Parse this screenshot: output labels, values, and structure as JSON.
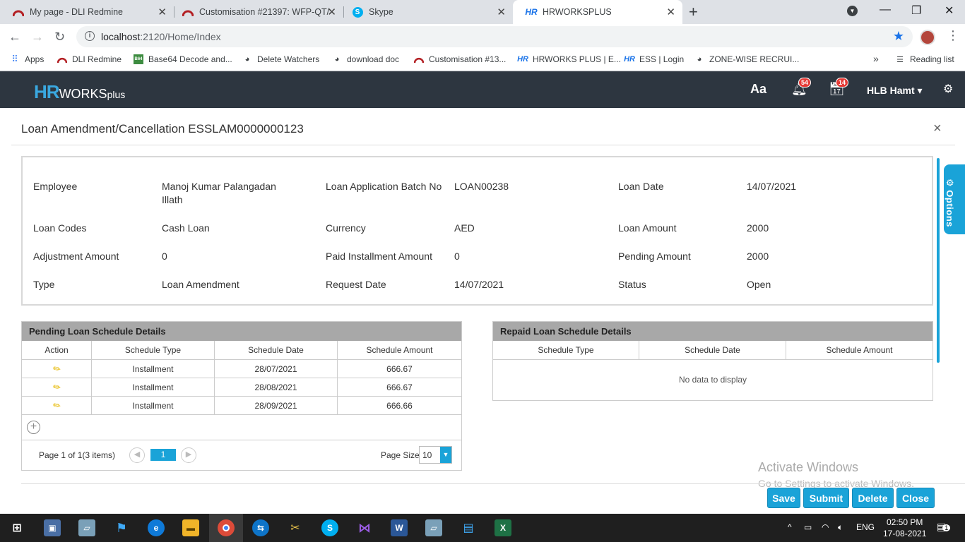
{
  "browser": {
    "tabs": [
      {
        "title": "My page - DLI Redmine",
        "active": false
      },
      {
        "title": "Customisation #21397: WFP-QT/",
        "active": false
      },
      {
        "title": "Skype",
        "active": false
      },
      {
        "title": "HRWORKSPLUS",
        "active": true
      }
    ],
    "url_host": "localhost",
    "url_path": ":2120/Home/Index",
    "bookmarks": [
      "Apps",
      "DLI Redmine",
      "Base64 Decode and...",
      "Delete Watchers",
      "download doc",
      "Customisation #13...",
      "HRWORKS PLUS | E...",
      "ESS | Login",
      "ZONE-WISE RECRUI..."
    ],
    "bookmarks_more": "»",
    "reading_list": "Reading list"
  },
  "app": {
    "logo_hr": "HR",
    "logo_works": "WORKS",
    "logo_plus": "plus",
    "font_icon": "Aa",
    "notif_count": "54",
    "task_count": "14",
    "user": "HLB Hamt ▾"
  },
  "page": {
    "title": "Loan Amendment/Cancellation ESSLAM0000000123",
    "close": "×",
    "options_label": "Options"
  },
  "info": {
    "employee_label": "Employee",
    "employee": "Manoj Kumar Palangadan Illath",
    "batch_label": "Loan Application Batch No",
    "batch": "LOAN00238",
    "loan_date_label": "Loan Date",
    "loan_date": "14/07/2021",
    "loan_codes_label": "Loan Codes",
    "loan_codes": "Cash Loan",
    "currency_label": "Currency",
    "currency": "AED",
    "loan_amount_label": "Loan Amount",
    "loan_amount": "2000",
    "adjustment_label": "Adjustment Amount",
    "adjustment": "0",
    "paid_label": "Paid Installment Amount",
    "paid": "0",
    "pending_label": "Pending Amount",
    "pending": "2000",
    "type_label": "Type",
    "type": "Loan Amendment",
    "request_date_label": "Request Date",
    "request_date": "14/07/2021",
    "status_label": "Status",
    "status": "Open"
  },
  "pending_grid": {
    "title": "Pending Loan Schedule Details",
    "columns": [
      "Action",
      "Schedule Type",
      "Schedule Date",
      "Schedule Amount"
    ],
    "rows": [
      {
        "type": "Installment",
        "date": "28/07/2021",
        "amount": "666.67"
      },
      {
        "type": "Installment",
        "date": "28/08/2021",
        "amount": "666.67"
      },
      {
        "type": "Installment",
        "date": "28/09/2021",
        "amount": "666.66"
      }
    ],
    "page_info": "Page 1 of 1(3 items)",
    "current_page": "1",
    "page_size_label": "Page Size",
    "page_size": "10"
  },
  "repaid_grid": {
    "title": "Repaid Loan Schedule Details",
    "columns": [
      "Schedule Type",
      "Schedule Date",
      "Schedule Amount"
    ],
    "empty": "No data to display"
  },
  "watermark": {
    "line1": "Activate Windows",
    "line2": "Go to Settings to activate Windows."
  },
  "buttons": {
    "save": "Save",
    "submit": "Submit",
    "delete": "Delete",
    "close": "Close"
  },
  "taskbar": {
    "lang": "ENG",
    "time": "02:50 PM",
    "date": "17-08-2021",
    "notif": "1"
  }
}
